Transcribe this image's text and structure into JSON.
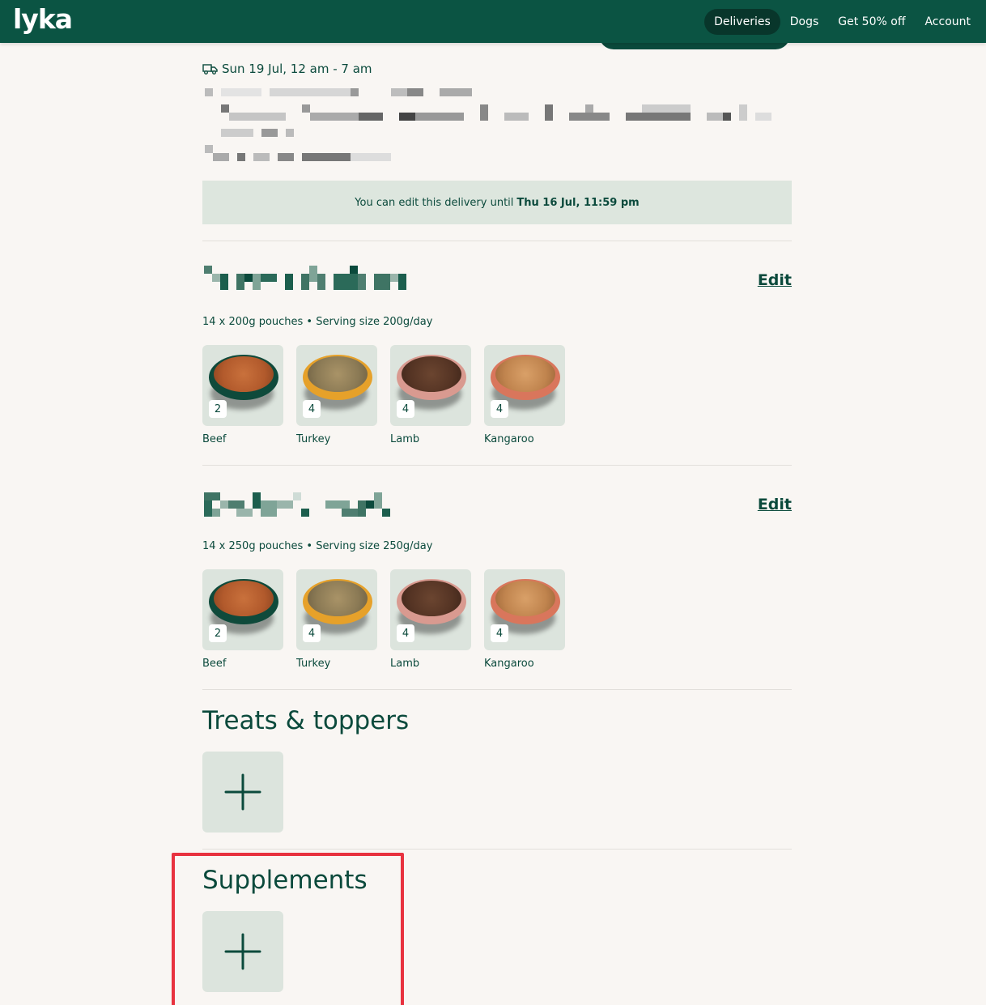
{
  "brand": {
    "logo_text": "lyka"
  },
  "nav": {
    "items": [
      {
        "label": "Deliveries",
        "active": true
      },
      {
        "label": "Dogs"
      },
      {
        "label": "Get 50% off"
      },
      {
        "label": "Account"
      }
    ]
  },
  "delivery": {
    "time_text": "Sun 19 Jul, 12 am - 7 am",
    "notice_prefix": "You can edit this delivery until",
    "notice_deadline": "Thu 16 Jul, 11:59 pm"
  },
  "plans": [
    {
      "edit_label": "Edit",
      "meta": "14 x 200g pouches • Serving size 200g/day",
      "recipes": [
        {
          "name": "Beef",
          "count": "2"
        },
        {
          "name": "Turkey",
          "count": "4"
        },
        {
          "name": "Lamb",
          "count": "4"
        },
        {
          "name": "Kangaroo",
          "count": "4"
        }
      ]
    },
    {
      "edit_label": "Edit",
      "meta": "14 x 250g pouches • Serving size 250g/day",
      "recipes": [
        {
          "name": "Beef",
          "count": "2"
        },
        {
          "name": "Turkey",
          "count": "4"
        },
        {
          "name": "Lamb",
          "count": "4"
        },
        {
          "name": "Kangaroo",
          "count": "4"
        }
      ]
    }
  ],
  "treats": {
    "title": "Treats & toppers"
  },
  "supplements": {
    "title": "Supplements"
  },
  "colors": {
    "brand_green": "#0b5443",
    "highlight_red": "#e8323f",
    "bowl_beef": "#0f4a3b",
    "bowl_turkey": "#e6a12a",
    "bowl_lamb": "#d99a90",
    "bowl_kangaroo": "#d9765c"
  }
}
